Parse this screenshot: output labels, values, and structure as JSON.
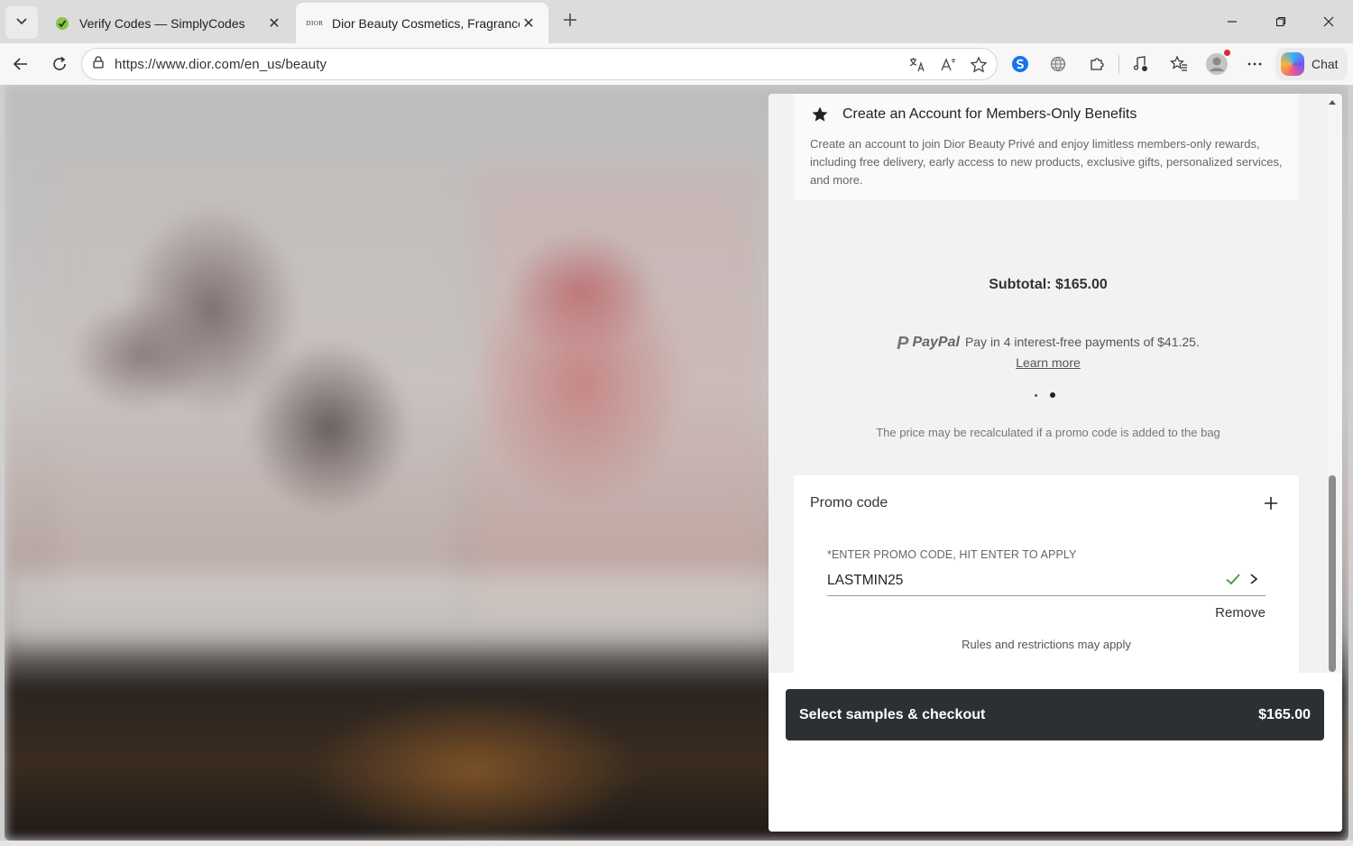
{
  "browser": {
    "tabs": [
      {
        "title": "Verify Codes — SimplyCodes",
        "favicon": "simplycodes-icon",
        "active": false
      },
      {
        "title": "Dior Beauty Cosmetics, Fragrance,",
        "favicon": "dior-icon",
        "favicon_text": "DIOR",
        "active": true
      }
    ],
    "address": {
      "url": "https://www.dior.com/en_us/beauty"
    },
    "chat_label": "Chat"
  },
  "drawer": {
    "account_card": {
      "title": "Create an Account for Members-Only Benefits",
      "description": "Create an account to join Dior Beauty Privé and enjoy limitless members-only rewards, including free delivery, early access to new products, exclusive gifts, personalized services, and more."
    },
    "subtotal": "Subtotal: $165.00",
    "paypal": {
      "brand": "PayPal",
      "message": "Pay in 4 interest-free payments of $41.25.",
      "learn_more": "Learn more"
    },
    "carousel": {
      "count": 2,
      "active_index": 1
    },
    "recalc_notice": "The price may be recalculated if a promo code is added to the bag",
    "promo": {
      "title": "Promo code",
      "field_label": "*ENTER PROMO CODE, HIT ENTER TO APPLY",
      "value": "LASTMIN25",
      "remove_label": "Remove",
      "rules": "Rules and restrictions may apply",
      "valid_color": "#3a9a3a"
    },
    "checkout": {
      "label": "Select samples & checkout",
      "price": "$165.00",
      "button_color": "#2c3033"
    }
  }
}
